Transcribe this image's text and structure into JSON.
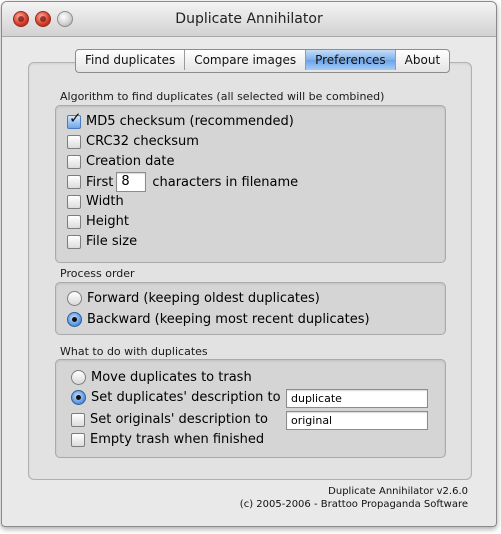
{
  "window": {
    "title": "Duplicate Annihilator"
  },
  "tabs": [
    {
      "label": "Find duplicates",
      "active": false
    },
    {
      "label": "Compare images",
      "active": false
    },
    {
      "label": "Preferences",
      "active": true
    },
    {
      "label": "About",
      "active": false
    }
  ],
  "algorithm": {
    "heading": "Algorithm to find duplicates (all selected will be combined)",
    "options": [
      {
        "label": "MD5 checksum (recommended)",
        "checked": true
      },
      {
        "label": "CRC32 checksum",
        "checked": false
      },
      {
        "label": "Creation date",
        "checked": false
      },
      {
        "label_before": "First",
        "value": "8",
        "label_after": "characters in filename",
        "checked": false
      },
      {
        "label": "Width",
        "checked": false
      },
      {
        "label": "Height",
        "checked": false
      },
      {
        "label": "File size",
        "checked": false
      }
    ]
  },
  "process_order": {
    "heading": "Process order",
    "options": [
      {
        "label": "Forward (keeping oldest duplicates)",
        "selected": false
      },
      {
        "label": "Backward (keeping most recent duplicates)",
        "selected": true
      }
    ]
  },
  "duplicates_action": {
    "heading": "What to do with duplicates",
    "move_to_trash": {
      "label": "Move duplicates to trash",
      "selected": false
    },
    "set_dup_description": {
      "label": "Set duplicates' description to",
      "selected": true,
      "value": "duplicate"
    },
    "set_orig_description": {
      "label": "Set originals' description to",
      "checked": false,
      "value": "original"
    },
    "empty_trash": {
      "label": "Empty trash when finished",
      "checked": false
    }
  },
  "footer": {
    "version": "Duplicate Annihilator v2.6.0",
    "copyright": "(c) 2005-2006 - Brattoo Propaganda Software"
  },
  "colors": {
    "accent": "#6aa2e6",
    "window_bg": "#e9e9e9",
    "group_bg": "#d5d5d5"
  }
}
